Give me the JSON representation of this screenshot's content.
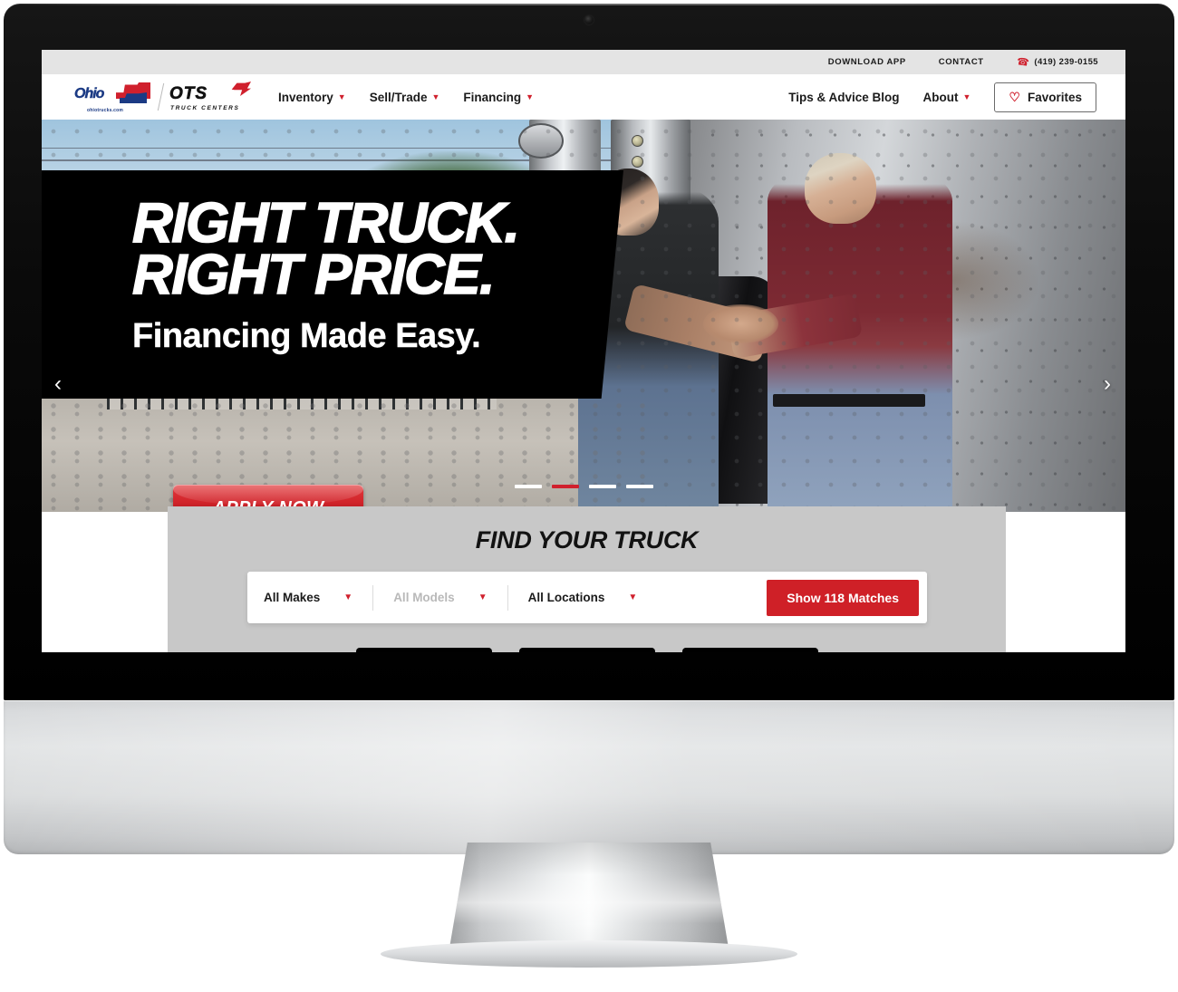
{
  "device": {
    "type": "desktop-monitor",
    "webcam": "webcam-dot"
  },
  "utility_bar": {
    "links": [
      {
        "label": "DOWNLOAD APP"
      },
      {
        "label": "CONTACT"
      }
    ],
    "phone": {
      "icon": "phone-icon",
      "number": "(419) 239-0155"
    }
  },
  "logo": {
    "primary_word": "Ohio",
    "primary_sub": "ohiotrucks.com",
    "secondary_word": "OTS",
    "secondary_sub": "TRUCK CENTERS"
  },
  "nav": {
    "left_items": [
      {
        "label": "Inventory",
        "has_dropdown": true
      },
      {
        "label": "Sell/Trade",
        "has_dropdown": true
      },
      {
        "label": "Financing",
        "has_dropdown": true
      }
    ],
    "right_items": [
      {
        "label": "Tips & Advice Blog",
        "has_dropdown": false
      },
      {
        "label": "About",
        "has_dropdown": true
      }
    ],
    "favorites_button": {
      "label": "Favorites",
      "icon": "heart-icon"
    }
  },
  "hero": {
    "headline_line1": "RIGHT TRUCK.",
    "headline_line2": "RIGHT PRICE.",
    "subhead": "Financing Made Easy.",
    "cta_label": "APPLY NOW",
    "arrow_prev": "‹",
    "arrow_next": "›",
    "slides_total": 4,
    "active_slide": 2,
    "image_alt": "Salesperson and customer shaking hands in front of a chrome semi truck"
  },
  "find_truck": {
    "title": "FIND YOUR TRUCK",
    "filters": [
      {
        "name": "makes",
        "value": "All Makes",
        "disabled": false
      },
      {
        "name": "models",
        "value": "All Models",
        "disabled": true
      },
      {
        "name": "locations",
        "value": "All Locations",
        "disabled": false
      }
    ],
    "submit_label": "Show 118 Matches",
    "match_count": 118
  },
  "colors": {
    "brand_red": "#d0202d",
    "button_red": "#cf2027",
    "panel_grey": "#c8c8c8",
    "utility_grey": "#e4e4e4",
    "logo_blue": "#1b3a84"
  }
}
